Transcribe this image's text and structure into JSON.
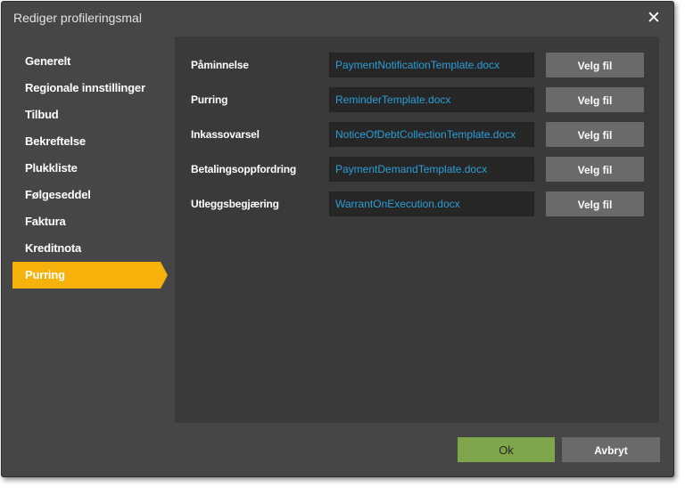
{
  "dialog": {
    "title": "Rediger profileringsmal",
    "close_glyph": "✕"
  },
  "sidebar": {
    "items": [
      {
        "label": "Generelt"
      },
      {
        "label": "Regionale innstillinger"
      },
      {
        "label": "Tilbud"
      },
      {
        "label": "Bekreftelse"
      },
      {
        "label": "Plukkliste"
      },
      {
        "label": "Følgeseddel"
      },
      {
        "label": "Faktura"
      },
      {
        "label": "Kreditnota"
      },
      {
        "label": "Purring"
      }
    ],
    "active_index": 8,
    "active_color": "#f6b10b"
  },
  "templates": {
    "rows": [
      {
        "label": "Påminnelse",
        "file": "PaymentNotificationTemplate.docx",
        "button": "Velg fil"
      },
      {
        "label": "Purring",
        "file": "ReminderTemplate.docx",
        "button": "Velg fil"
      },
      {
        "label": "Inkassovarsel",
        "file": "NoticeOfDebtCollectionTemplate.docx",
        "button": "Velg fil"
      },
      {
        "label": "Betalingsoppfordring",
        "file": "PaymentDemandTemplate.docx",
        "button": "Velg fil"
      },
      {
        "label": "Utleggsbegjæring",
        "file": "WarrantOnExecution.docx",
        "button": "Velg fil"
      }
    ]
  },
  "footer": {
    "ok_label": "Ok",
    "cancel_label": "Avbryt"
  },
  "colors": {
    "dialog_bg": "#464646",
    "panel_bg": "#3a3a3a",
    "link_blue": "#2d9fd8",
    "ok_green": "#7fa64a"
  }
}
